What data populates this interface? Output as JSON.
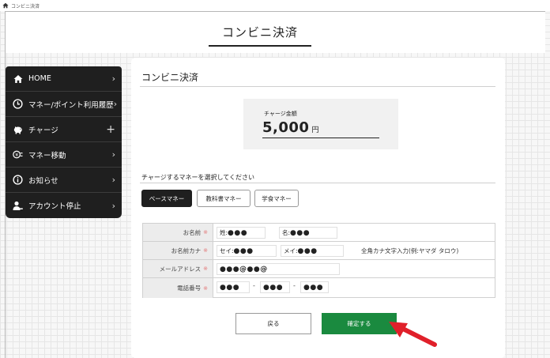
{
  "breadcrumb": {
    "label": "コンビニ決済"
  },
  "header": {
    "title": "コンビニ決済"
  },
  "sidebar": {
    "items": [
      {
        "label": "HOME",
        "icon": "home-icon",
        "indicator": "›"
      },
      {
        "label": "マネー/ポイント利用履歴",
        "icon": "clock-icon",
        "indicator": "›"
      },
      {
        "label": "チャージ",
        "icon": "piggy-bank-icon",
        "indicator": "+"
      },
      {
        "label": "マネー移動",
        "icon": "money-transfer-icon",
        "indicator": "›"
      },
      {
        "label": "お知らせ",
        "icon": "info-icon",
        "indicator": "›"
      },
      {
        "label": "アカウント停止",
        "icon": "user-stop-icon",
        "indicator": "›"
      }
    ]
  },
  "panel": {
    "title": "コンビニ決済",
    "charge": {
      "label": "チャージ金額",
      "amount": "5,000",
      "unit": "円"
    },
    "select_label": "チャージするマネーを選択してください",
    "money_options": [
      {
        "label": "ベースマネー",
        "selected": true
      },
      {
        "label": "教科書マネー",
        "selected": false
      },
      {
        "label": "学食マネー",
        "selected": false
      }
    ]
  },
  "form": {
    "required_mark": "※",
    "name": {
      "label": "お名前",
      "last_prefix": "姓:",
      "last_value": "●●●",
      "first_prefix": "名:",
      "first_value": "●●●"
    },
    "kana": {
      "label": "お名前カナ",
      "last_prefix": "セイ:",
      "last_value": "●●●",
      "first_prefix": "メイ:",
      "first_value": "●●●",
      "hint": "全角カナ文字入力(例:ヤマダ タロウ)"
    },
    "email": {
      "label": "メールアドレス",
      "value": "●●●@●●@"
    },
    "phone": {
      "label": "電話番号",
      "part1": "●●●",
      "part2": "●●●",
      "part3": "●●●",
      "separator": "-"
    }
  },
  "actions": {
    "back_label": "戻る",
    "confirm_label": "確定する"
  },
  "colors": {
    "sidebar_bg": "#1f1f1f",
    "confirm_bg": "#1a8a3f",
    "arrow": "#e0202a",
    "required": "#e37a7a"
  }
}
